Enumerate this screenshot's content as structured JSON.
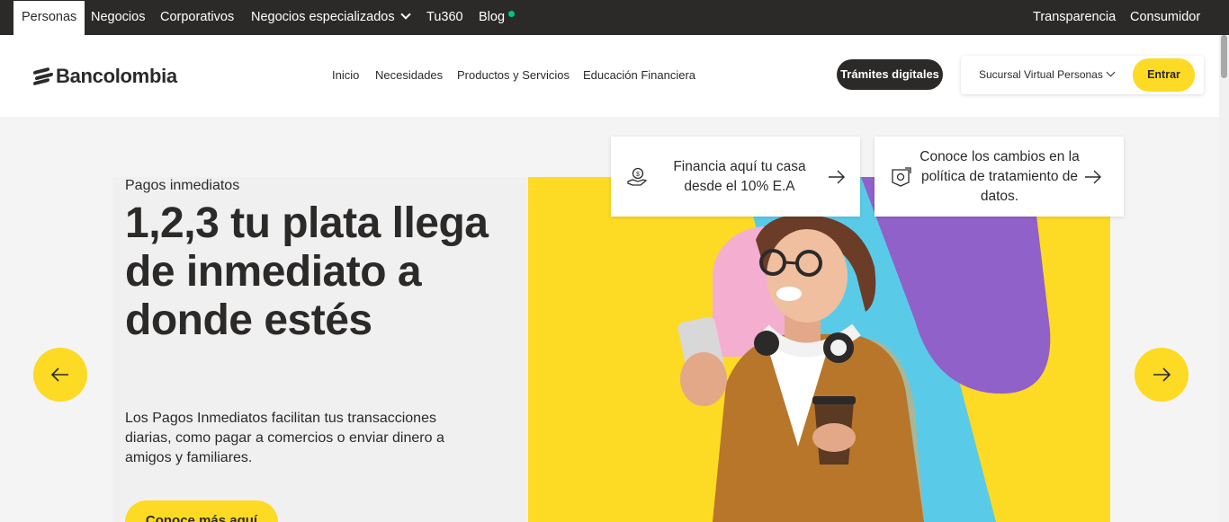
{
  "topbar": {
    "tabs": [
      {
        "label": "Personas"
      },
      {
        "label": "Negocios"
      },
      {
        "label": "Corporativos"
      },
      {
        "label": "Negocios especializados"
      },
      {
        "label": "Tu360"
      },
      {
        "label": "Blog"
      }
    ],
    "right": [
      "Transparencia",
      "Consumidor"
    ]
  },
  "header": {
    "logo_text": "Bancolombia",
    "nav": [
      "Inicio",
      "Necesidades",
      "Productos y Servicios",
      "Educación Financiera"
    ],
    "tramites_label": "Trámites digitales",
    "sucursal_label": "Sucursal Virtual Personas",
    "entrar_label": "Entrar"
  },
  "cards": [
    {
      "text": "Financia aquí tu casa desde el 10% E.A",
      "icon": "hand-coin-icon"
    },
    {
      "text": "Conoce los cambios en la política de tratamiento de datos.",
      "icon": "data-shield-icon"
    }
  ],
  "hero": {
    "eyebrow": "Pagos inmediatos",
    "headline": "1,2,3 tu plata llega de inmediato a donde estés",
    "description": "Los Pagos Inmediatos facilitan tus transacciones diarias, como pagar a comercios o enviar dinero a amigos y familiares.",
    "cta_label": "Conoce más aquí"
  },
  "colors": {
    "brand_yellow": "#fdda24",
    "dark": "#2c2a29",
    "new_dot": "#00c389"
  }
}
